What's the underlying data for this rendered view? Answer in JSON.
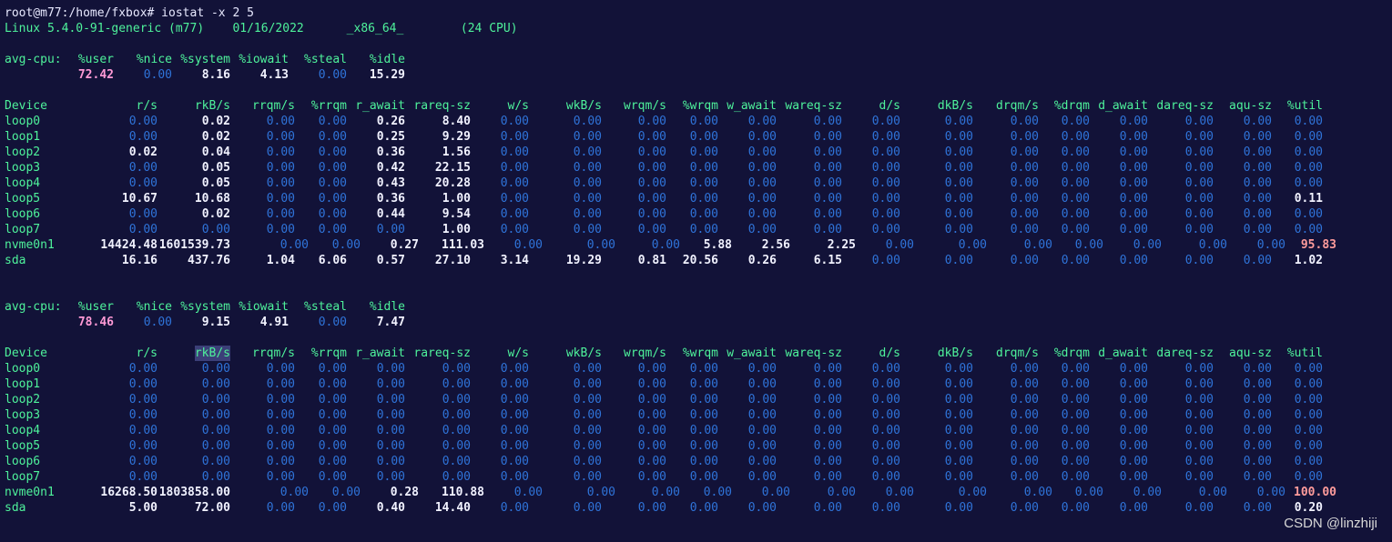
{
  "terminal": {
    "prompt": "root@m77:/home/fxbox# iostat -x 2 5",
    "sysinfo": "Linux 5.4.0-91-generic (m77)    01/16/2022      _x86_64_        (24 CPU)"
  },
  "cpu_headers": [
    "avg-cpu:",
    "%user",
    "%nice",
    "%system",
    "%iowait",
    "%steal",
    "%idle"
  ],
  "device_headers": [
    "Device",
    "r/s",
    "rkB/s",
    "rrqm/s",
    "%rrqm",
    "r_await",
    "rareq-sz",
    "w/s",
    "wkB/s",
    "wrqm/s",
    "%wrqm",
    "w_await",
    "wareq-sz",
    "d/s",
    "dkB/s",
    "drqm/s",
    "%drqm",
    "d_await",
    "dareq-sz",
    "aqu-sz",
    "%util"
  ],
  "blocks": [
    {
      "cpu": [
        "72.42",
        "0.00",
        "8.16",
        "4.13",
        "0.00",
        "15.29"
      ],
      "devices": [
        {
          "name": "loop0",
          "v": [
            "0.00",
            "0.02",
            "0.00",
            "0.00",
            "0.26",
            "8.40",
            "0.00",
            "0.00",
            "0.00",
            "0.00",
            "0.00",
            "0.00",
            "0.00",
            "0.00",
            "0.00",
            "0.00",
            "0.00",
            "0.00",
            "0.00",
            "0.00"
          ]
        },
        {
          "name": "loop1",
          "v": [
            "0.00",
            "0.02",
            "0.00",
            "0.00",
            "0.25",
            "9.29",
            "0.00",
            "0.00",
            "0.00",
            "0.00",
            "0.00",
            "0.00",
            "0.00",
            "0.00",
            "0.00",
            "0.00",
            "0.00",
            "0.00",
            "0.00",
            "0.00"
          ]
        },
        {
          "name": "loop2",
          "v": [
            "0.02",
            "0.04",
            "0.00",
            "0.00",
            "0.36",
            "1.56",
            "0.00",
            "0.00",
            "0.00",
            "0.00",
            "0.00",
            "0.00",
            "0.00",
            "0.00",
            "0.00",
            "0.00",
            "0.00",
            "0.00",
            "0.00",
            "0.00"
          ]
        },
        {
          "name": "loop3",
          "v": [
            "0.00",
            "0.05",
            "0.00",
            "0.00",
            "0.42",
            "22.15",
            "0.00",
            "0.00",
            "0.00",
            "0.00",
            "0.00",
            "0.00",
            "0.00",
            "0.00",
            "0.00",
            "0.00",
            "0.00",
            "0.00",
            "0.00",
            "0.00"
          ]
        },
        {
          "name": "loop4",
          "v": [
            "0.00",
            "0.05",
            "0.00",
            "0.00",
            "0.43",
            "20.28",
            "0.00",
            "0.00",
            "0.00",
            "0.00",
            "0.00",
            "0.00",
            "0.00",
            "0.00",
            "0.00",
            "0.00",
            "0.00",
            "0.00",
            "0.00",
            "0.00"
          ]
        },
        {
          "name": "loop5",
          "v": [
            "10.67",
            "10.68",
            "0.00",
            "0.00",
            "0.36",
            "1.00",
            "0.00",
            "0.00",
            "0.00",
            "0.00",
            "0.00",
            "0.00",
            "0.00",
            "0.00",
            "0.00",
            "0.00",
            "0.00",
            "0.00",
            "0.00",
            "0.11"
          ]
        },
        {
          "name": "loop6",
          "v": [
            "0.00",
            "0.02",
            "0.00",
            "0.00",
            "0.44",
            "9.54",
            "0.00",
            "0.00",
            "0.00",
            "0.00",
            "0.00",
            "0.00",
            "0.00",
            "0.00",
            "0.00",
            "0.00",
            "0.00",
            "0.00",
            "0.00",
            "0.00"
          ]
        },
        {
          "name": "loop7",
          "v": [
            "0.00",
            "0.00",
            "0.00",
            "0.00",
            "0.00",
            "1.00",
            "0.00",
            "0.00",
            "0.00",
            "0.00",
            "0.00",
            "0.00",
            "0.00",
            "0.00",
            "0.00",
            "0.00",
            "0.00",
            "0.00",
            "0.00",
            "0.00"
          ]
        },
        {
          "name": "nvme0n1",
          "v": [
            "14424.48",
            "1601539.73",
            "0.00",
            "0.00",
            "0.27",
            "111.03",
            "0.00",
            "0.00",
            "0.00",
            "5.88",
            "2.56",
            "2.25",
            "0.00",
            "0.00",
            "0.00",
            "0.00",
            "0.00",
            "0.00",
            "0.00",
            "95.83"
          ]
        },
        {
          "name": "sda",
          "v": [
            "16.16",
            "437.76",
            "1.04",
            "6.06",
            "0.57",
            "27.10",
            "3.14",
            "19.29",
            "0.81",
            "20.56",
            "0.26",
            "6.15",
            "0.00",
            "0.00",
            "0.00",
            "0.00",
            "0.00",
            "0.00",
            "0.00",
            "1.02"
          ]
        }
      ]
    },
    {
      "cpu": [
        "78.46",
        "0.00",
        "9.15",
        "4.91",
        "0.00",
        "7.47"
      ],
      "devices": [
        {
          "name": "loop0",
          "v": [
            "0.00",
            "0.00",
            "0.00",
            "0.00",
            "0.00",
            "0.00",
            "0.00",
            "0.00",
            "0.00",
            "0.00",
            "0.00",
            "0.00",
            "0.00",
            "0.00",
            "0.00",
            "0.00",
            "0.00",
            "0.00",
            "0.00",
            "0.00"
          ]
        },
        {
          "name": "loop1",
          "v": [
            "0.00",
            "0.00",
            "0.00",
            "0.00",
            "0.00",
            "0.00",
            "0.00",
            "0.00",
            "0.00",
            "0.00",
            "0.00",
            "0.00",
            "0.00",
            "0.00",
            "0.00",
            "0.00",
            "0.00",
            "0.00",
            "0.00",
            "0.00"
          ]
        },
        {
          "name": "loop2",
          "v": [
            "0.00",
            "0.00",
            "0.00",
            "0.00",
            "0.00",
            "0.00",
            "0.00",
            "0.00",
            "0.00",
            "0.00",
            "0.00",
            "0.00",
            "0.00",
            "0.00",
            "0.00",
            "0.00",
            "0.00",
            "0.00",
            "0.00",
            "0.00"
          ]
        },
        {
          "name": "loop3",
          "v": [
            "0.00",
            "0.00",
            "0.00",
            "0.00",
            "0.00",
            "0.00",
            "0.00",
            "0.00",
            "0.00",
            "0.00",
            "0.00",
            "0.00",
            "0.00",
            "0.00",
            "0.00",
            "0.00",
            "0.00",
            "0.00",
            "0.00",
            "0.00"
          ]
        },
        {
          "name": "loop4",
          "v": [
            "0.00",
            "0.00",
            "0.00",
            "0.00",
            "0.00",
            "0.00",
            "0.00",
            "0.00",
            "0.00",
            "0.00",
            "0.00",
            "0.00",
            "0.00",
            "0.00",
            "0.00",
            "0.00",
            "0.00",
            "0.00",
            "0.00",
            "0.00"
          ]
        },
        {
          "name": "loop5",
          "v": [
            "0.00",
            "0.00",
            "0.00",
            "0.00",
            "0.00",
            "0.00",
            "0.00",
            "0.00",
            "0.00",
            "0.00",
            "0.00",
            "0.00",
            "0.00",
            "0.00",
            "0.00",
            "0.00",
            "0.00",
            "0.00",
            "0.00",
            "0.00"
          ]
        },
        {
          "name": "loop6",
          "v": [
            "0.00",
            "0.00",
            "0.00",
            "0.00",
            "0.00",
            "0.00",
            "0.00",
            "0.00",
            "0.00",
            "0.00",
            "0.00",
            "0.00",
            "0.00",
            "0.00",
            "0.00",
            "0.00",
            "0.00",
            "0.00",
            "0.00",
            "0.00"
          ]
        },
        {
          "name": "loop7",
          "v": [
            "0.00",
            "0.00",
            "0.00",
            "0.00",
            "0.00",
            "0.00",
            "0.00",
            "0.00",
            "0.00",
            "0.00",
            "0.00",
            "0.00",
            "0.00",
            "0.00",
            "0.00",
            "0.00",
            "0.00",
            "0.00",
            "0.00",
            "0.00"
          ]
        },
        {
          "name": "nvme0n1",
          "v": [
            "16268.50",
            "1803858.00",
            "0.00",
            "0.00",
            "0.28",
            "110.88",
            "0.00",
            "0.00",
            "0.00",
            "0.00",
            "0.00",
            "0.00",
            "0.00",
            "0.00",
            "0.00",
            "0.00",
            "0.00",
            "0.00",
            "0.00",
            "100.00"
          ]
        },
        {
          "name": "sda",
          "v": [
            "5.00",
            "72.00",
            "0.00",
            "0.00",
            "0.40",
            "14.40",
            "0.00",
            "0.00",
            "0.00",
            "0.00",
            "0.00",
            "0.00",
            "0.00",
            "0.00",
            "0.00",
            "0.00",
            "0.00",
            "0.00",
            "0.00",
            "0.20"
          ]
        }
      ]
    }
  ],
  "watermark": "CSDN @linzhiji",
  "colors": {
    "background": "#121238",
    "header": "#4ef29b",
    "zero": "#2f73d8",
    "value": "#f1f2ff",
    "user": "#ff9ad6",
    "util": "#ff9c9c"
  }
}
